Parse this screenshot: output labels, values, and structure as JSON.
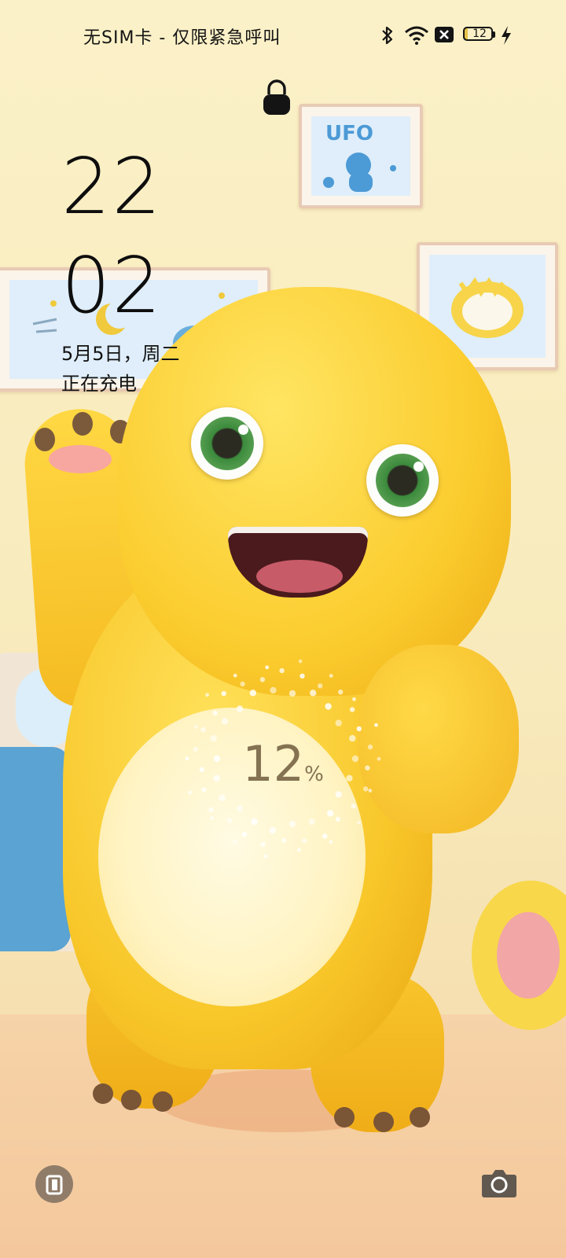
{
  "status_bar": {
    "carrier": "无SIM卡 - 仅限紧急呼叫",
    "battery_level": "12",
    "icons": [
      "bluetooth-icon",
      "wifi-icon",
      "no-sim-icon",
      "battery-icon",
      "charging-bolt-icon"
    ]
  },
  "lock": {
    "icon": "lock-icon"
  },
  "clock": {
    "hour": "22",
    "minute": "02",
    "date": "5月5日，周二",
    "status": "正在充电"
  },
  "charging": {
    "percent": "12",
    "unit": "%",
    "fill_fraction": 0.12
  },
  "shortcuts": {
    "left_icon": "wallet-card-icon",
    "right_icon": "camera-icon"
  },
  "colors": {
    "wallpaper_bg": "#f8eabb",
    "character_yellow": "#f8c72a",
    "text_dark": "#121212"
  }
}
